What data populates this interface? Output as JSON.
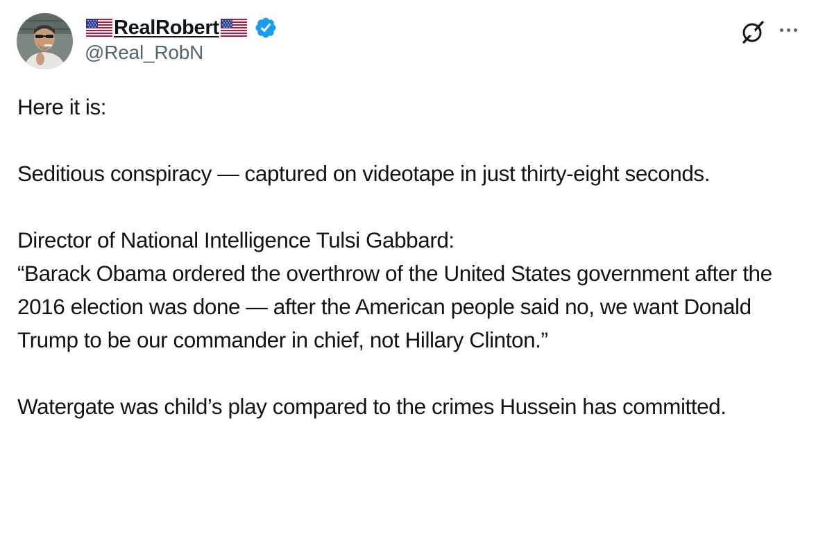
{
  "author": {
    "display_name": "RealRobert",
    "handle": "@Real_RobN",
    "leading_flag": "us-flag-icon",
    "trailing_flag": "us-flag-icon",
    "verified_badge": "verified-badge-icon",
    "verified_color": "#1d9bf0"
  },
  "actions": {
    "grok_icon": "grok-icon",
    "more_icon": "more-icon"
  },
  "post": {
    "line_1": "Here it is:",
    "line_2": "Seditious conspiracy — captured on videotape in just thirty-eight seconds.",
    "line_3": "Director of National Intelligence Tulsi Gabbard:",
    "line_4": "“Barack Obama ordered the overthrow of the United States government after the 2016 election was done — after the American people said no, we want Donald Trump to be our commander in chief, not Hillary Clinton.”",
    "line_5": "Watergate was child’s play compared to the crimes Hussein has committed."
  },
  "colors": {
    "text_primary": "#0f1419",
    "text_secondary": "#536471",
    "background": "#ffffff"
  }
}
